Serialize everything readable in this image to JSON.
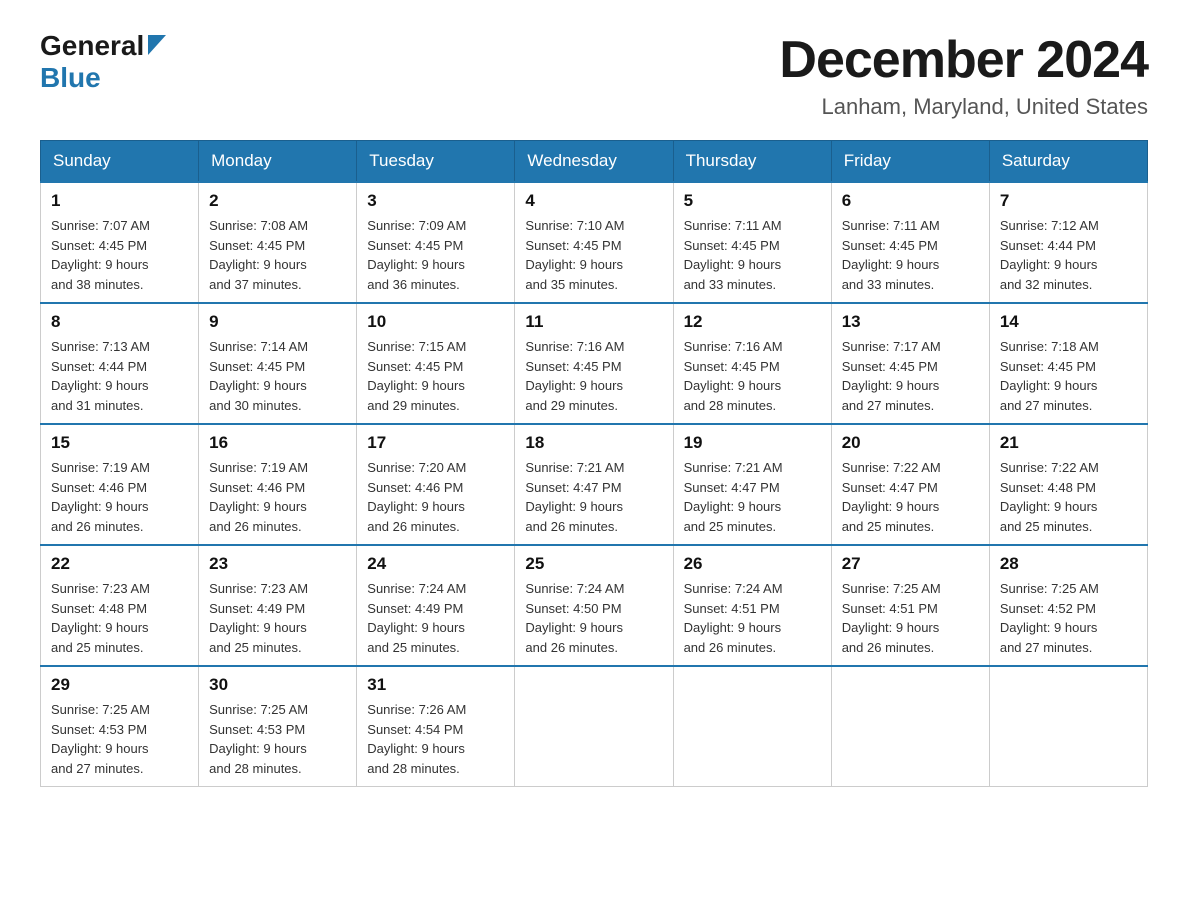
{
  "header": {
    "logo_general": "General",
    "logo_blue": "Blue",
    "month_title": "December 2024",
    "location": "Lanham, Maryland, United States"
  },
  "days_of_week": [
    "Sunday",
    "Monday",
    "Tuesday",
    "Wednesday",
    "Thursday",
    "Friday",
    "Saturday"
  ],
  "weeks": [
    [
      {
        "day": "1",
        "sunrise": "7:07 AM",
        "sunset": "4:45 PM",
        "daylight": "9 hours and 38 minutes."
      },
      {
        "day": "2",
        "sunrise": "7:08 AM",
        "sunset": "4:45 PM",
        "daylight": "9 hours and 37 minutes."
      },
      {
        "day": "3",
        "sunrise": "7:09 AM",
        "sunset": "4:45 PM",
        "daylight": "9 hours and 36 minutes."
      },
      {
        "day": "4",
        "sunrise": "7:10 AM",
        "sunset": "4:45 PM",
        "daylight": "9 hours and 35 minutes."
      },
      {
        "day": "5",
        "sunrise": "7:11 AM",
        "sunset": "4:45 PM",
        "daylight": "9 hours and 33 minutes."
      },
      {
        "day": "6",
        "sunrise": "7:11 AM",
        "sunset": "4:45 PM",
        "daylight": "9 hours and 33 minutes."
      },
      {
        "day": "7",
        "sunrise": "7:12 AM",
        "sunset": "4:44 PM",
        "daylight": "9 hours and 32 minutes."
      }
    ],
    [
      {
        "day": "8",
        "sunrise": "7:13 AM",
        "sunset": "4:44 PM",
        "daylight": "9 hours and 31 minutes."
      },
      {
        "day": "9",
        "sunrise": "7:14 AM",
        "sunset": "4:45 PM",
        "daylight": "9 hours and 30 minutes."
      },
      {
        "day": "10",
        "sunrise": "7:15 AM",
        "sunset": "4:45 PM",
        "daylight": "9 hours and 29 minutes."
      },
      {
        "day": "11",
        "sunrise": "7:16 AM",
        "sunset": "4:45 PM",
        "daylight": "9 hours and 29 minutes."
      },
      {
        "day": "12",
        "sunrise": "7:16 AM",
        "sunset": "4:45 PM",
        "daylight": "9 hours and 28 minutes."
      },
      {
        "day": "13",
        "sunrise": "7:17 AM",
        "sunset": "4:45 PM",
        "daylight": "9 hours and 27 minutes."
      },
      {
        "day": "14",
        "sunrise": "7:18 AM",
        "sunset": "4:45 PM",
        "daylight": "9 hours and 27 minutes."
      }
    ],
    [
      {
        "day": "15",
        "sunrise": "7:19 AM",
        "sunset": "4:46 PM",
        "daylight": "9 hours and 26 minutes."
      },
      {
        "day": "16",
        "sunrise": "7:19 AM",
        "sunset": "4:46 PM",
        "daylight": "9 hours and 26 minutes."
      },
      {
        "day": "17",
        "sunrise": "7:20 AM",
        "sunset": "4:46 PM",
        "daylight": "9 hours and 26 minutes."
      },
      {
        "day": "18",
        "sunrise": "7:21 AM",
        "sunset": "4:47 PM",
        "daylight": "9 hours and 26 minutes."
      },
      {
        "day": "19",
        "sunrise": "7:21 AM",
        "sunset": "4:47 PM",
        "daylight": "9 hours and 25 minutes."
      },
      {
        "day": "20",
        "sunrise": "7:22 AM",
        "sunset": "4:47 PM",
        "daylight": "9 hours and 25 minutes."
      },
      {
        "day": "21",
        "sunrise": "7:22 AM",
        "sunset": "4:48 PM",
        "daylight": "9 hours and 25 minutes."
      }
    ],
    [
      {
        "day": "22",
        "sunrise": "7:23 AM",
        "sunset": "4:48 PM",
        "daylight": "9 hours and 25 minutes."
      },
      {
        "day": "23",
        "sunrise": "7:23 AM",
        "sunset": "4:49 PM",
        "daylight": "9 hours and 25 minutes."
      },
      {
        "day": "24",
        "sunrise": "7:24 AM",
        "sunset": "4:49 PM",
        "daylight": "9 hours and 25 minutes."
      },
      {
        "day": "25",
        "sunrise": "7:24 AM",
        "sunset": "4:50 PM",
        "daylight": "9 hours and 26 minutes."
      },
      {
        "day": "26",
        "sunrise": "7:24 AM",
        "sunset": "4:51 PM",
        "daylight": "9 hours and 26 minutes."
      },
      {
        "day": "27",
        "sunrise": "7:25 AM",
        "sunset": "4:51 PM",
        "daylight": "9 hours and 26 minutes."
      },
      {
        "day": "28",
        "sunrise": "7:25 AM",
        "sunset": "4:52 PM",
        "daylight": "9 hours and 27 minutes."
      }
    ],
    [
      {
        "day": "29",
        "sunrise": "7:25 AM",
        "sunset": "4:53 PM",
        "daylight": "9 hours and 27 minutes."
      },
      {
        "day": "30",
        "sunrise": "7:25 AM",
        "sunset": "4:53 PM",
        "daylight": "9 hours and 28 minutes."
      },
      {
        "day": "31",
        "sunrise": "7:26 AM",
        "sunset": "4:54 PM",
        "daylight": "9 hours and 28 minutes."
      },
      null,
      null,
      null,
      null
    ]
  ],
  "labels": {
    "sunrise": "Sunrise:",
    "sunset": "Sunset:",
    "daylight": "Daylight:"
  }
}
